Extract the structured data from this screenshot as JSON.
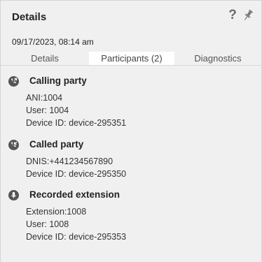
{
  "header": {
    "title": "Details",
    "help_label": "?"
  },
  "timestamp": "09/17/2023, 08:14 am",
  "tabs": [
    {
      "label": "Details",
      "active": false
    },
    {
      "label": "Participants (2)",
      "active": true
    },
    {
      "label": "Diagnostics",
      "active": false
    }
  ],
  "sections": {
    "calling": {
      "icon": "phone-outgoing-icon",
      "heading": "Calling party",
      "lines": [
        "ANI:1004",
        "User: 1004",
        "Device ID: device-295351"
      ]
    },
    "called": {
      "icon": "phone-incoming-icon",
      "heading": "Called party",
      "lines": [
        "DNIS:+441234567890",
        "Device ID: device-295350"
      ]
    },
    "recorded": {
      "icon": "microphone-icon",
      "heading": "Recorded extension",
      "lines": [
        "Extension:1008",
        "User: 1008",
        "Device ID: device-295353"
      ]
    }
  },
  "colors": {
    "panel_bg": "#f0f0f0",
    "active_tab_bg": "#ffffff",
    "icon_bg": "#555555"
  }
}
